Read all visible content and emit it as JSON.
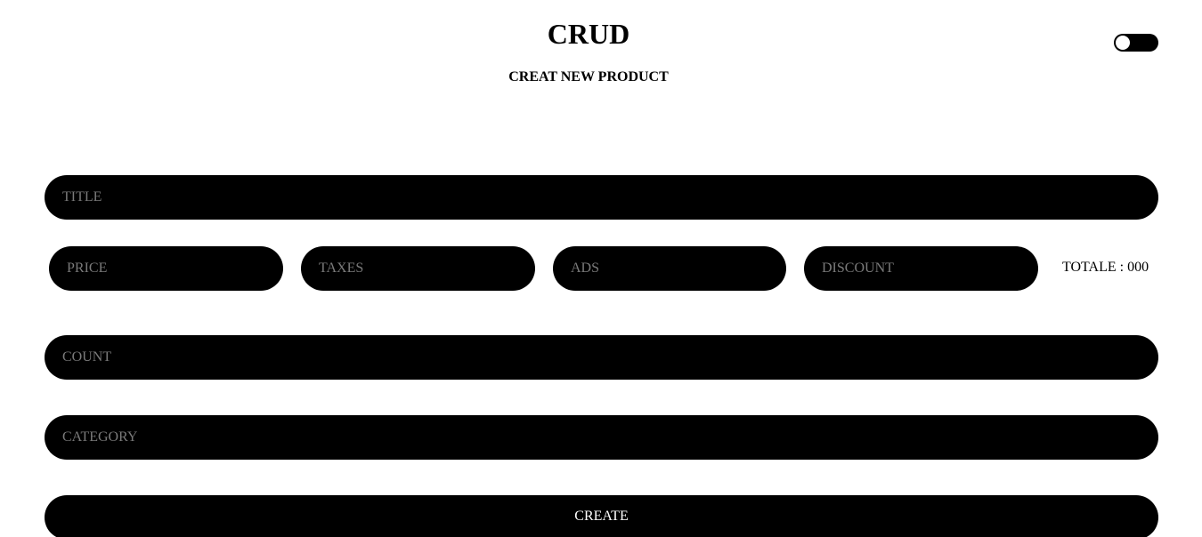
{
  "header": {
    "title": "CRUD",
    "subtitle": "CREAT NEW PRODUCT"
  },
  "theme_toggle": {
    "icon": "toggle-switch-icon",
    "state": "off"
  },
  "form": {
    "title_placeholder": "TITLE",
    "price_placeholder": "PRICE",
    "taxes_placeholder": "TAXES",
    "ads_placeholder": "ADS",
    "discount_placeholder": "DISCOUNT",
    "total_text": "TOTALE : 000",
    "count_placeholder": "COUNT",
    "category_placeholder": "CATEGORY",
    "create_label": "CREATE"
  },
  "colors": {
    "background": "#ffffff",
    "input_bg": "#000000",
    "placeholder": "#7a7a7a",
    "text": "#000000"
  }
}
